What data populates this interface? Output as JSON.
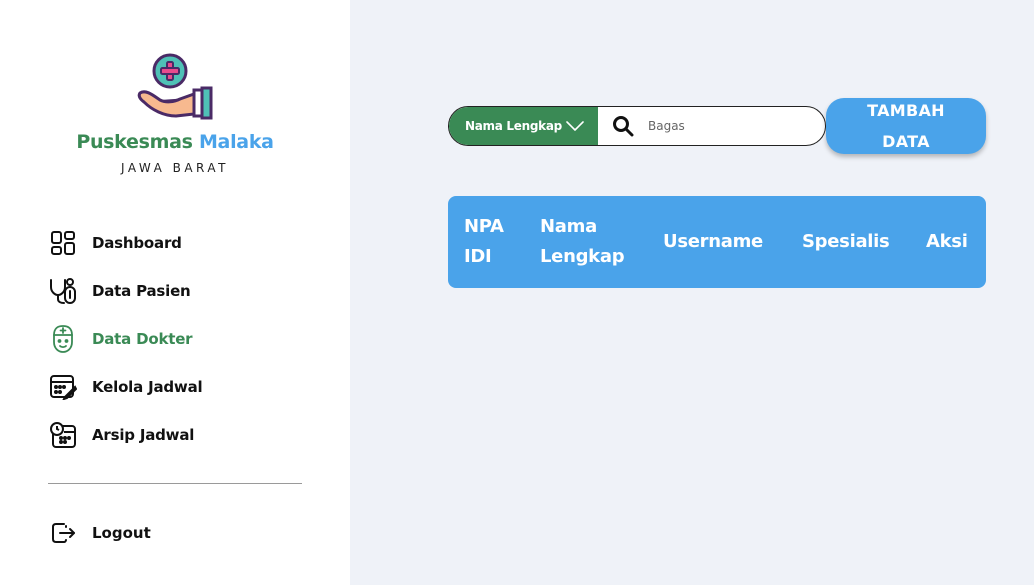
{
  "brand": {
    "name_part1": "Puskesmas",
    "name_part2": "Malaka",
    "region": "JAWA BARAT"
  },
  "sidebar": {
    "items": [
      {
        "label": "Dashboard",
        "icon": "dashboard-icon",
        "active": false
      },
      {
        "label": "Data Pasien",
        "icon": "stethoscope-icon",
        "active": false
      },
      {
        "label": "Data Dokter",
        "icon": "doctor-icon",
        "active": true
      },
      {
        "label": "Kelola Jadwal",
        "icon": "calendar-edit-icon",
        "active": false
      },
      {
        "label": "Arsip Jadwal",
        "icon": "schedule-archive-icon",
        "active": false
      }
    ],
    "logout_label": "Logout"
  },
  "search": {
    "filter_label": "Nama Lengkap",
    "placeholder": "Bagas"
  },
  "add_button": {
    "line1": "TAMBAH",
    "line2": "DATA"
  },
  "table": {
    "headers": [
      "NPA IDI",
      "Nama Lengkap",
      "Username",
      "Spesialis",
      "Aksi"
    ]
  },
  "colors": {
    "primary_green": "#3a8a55",
    "primary_blue": "#4aa3ea",
    "background": "#eff2f8"
  }
}
